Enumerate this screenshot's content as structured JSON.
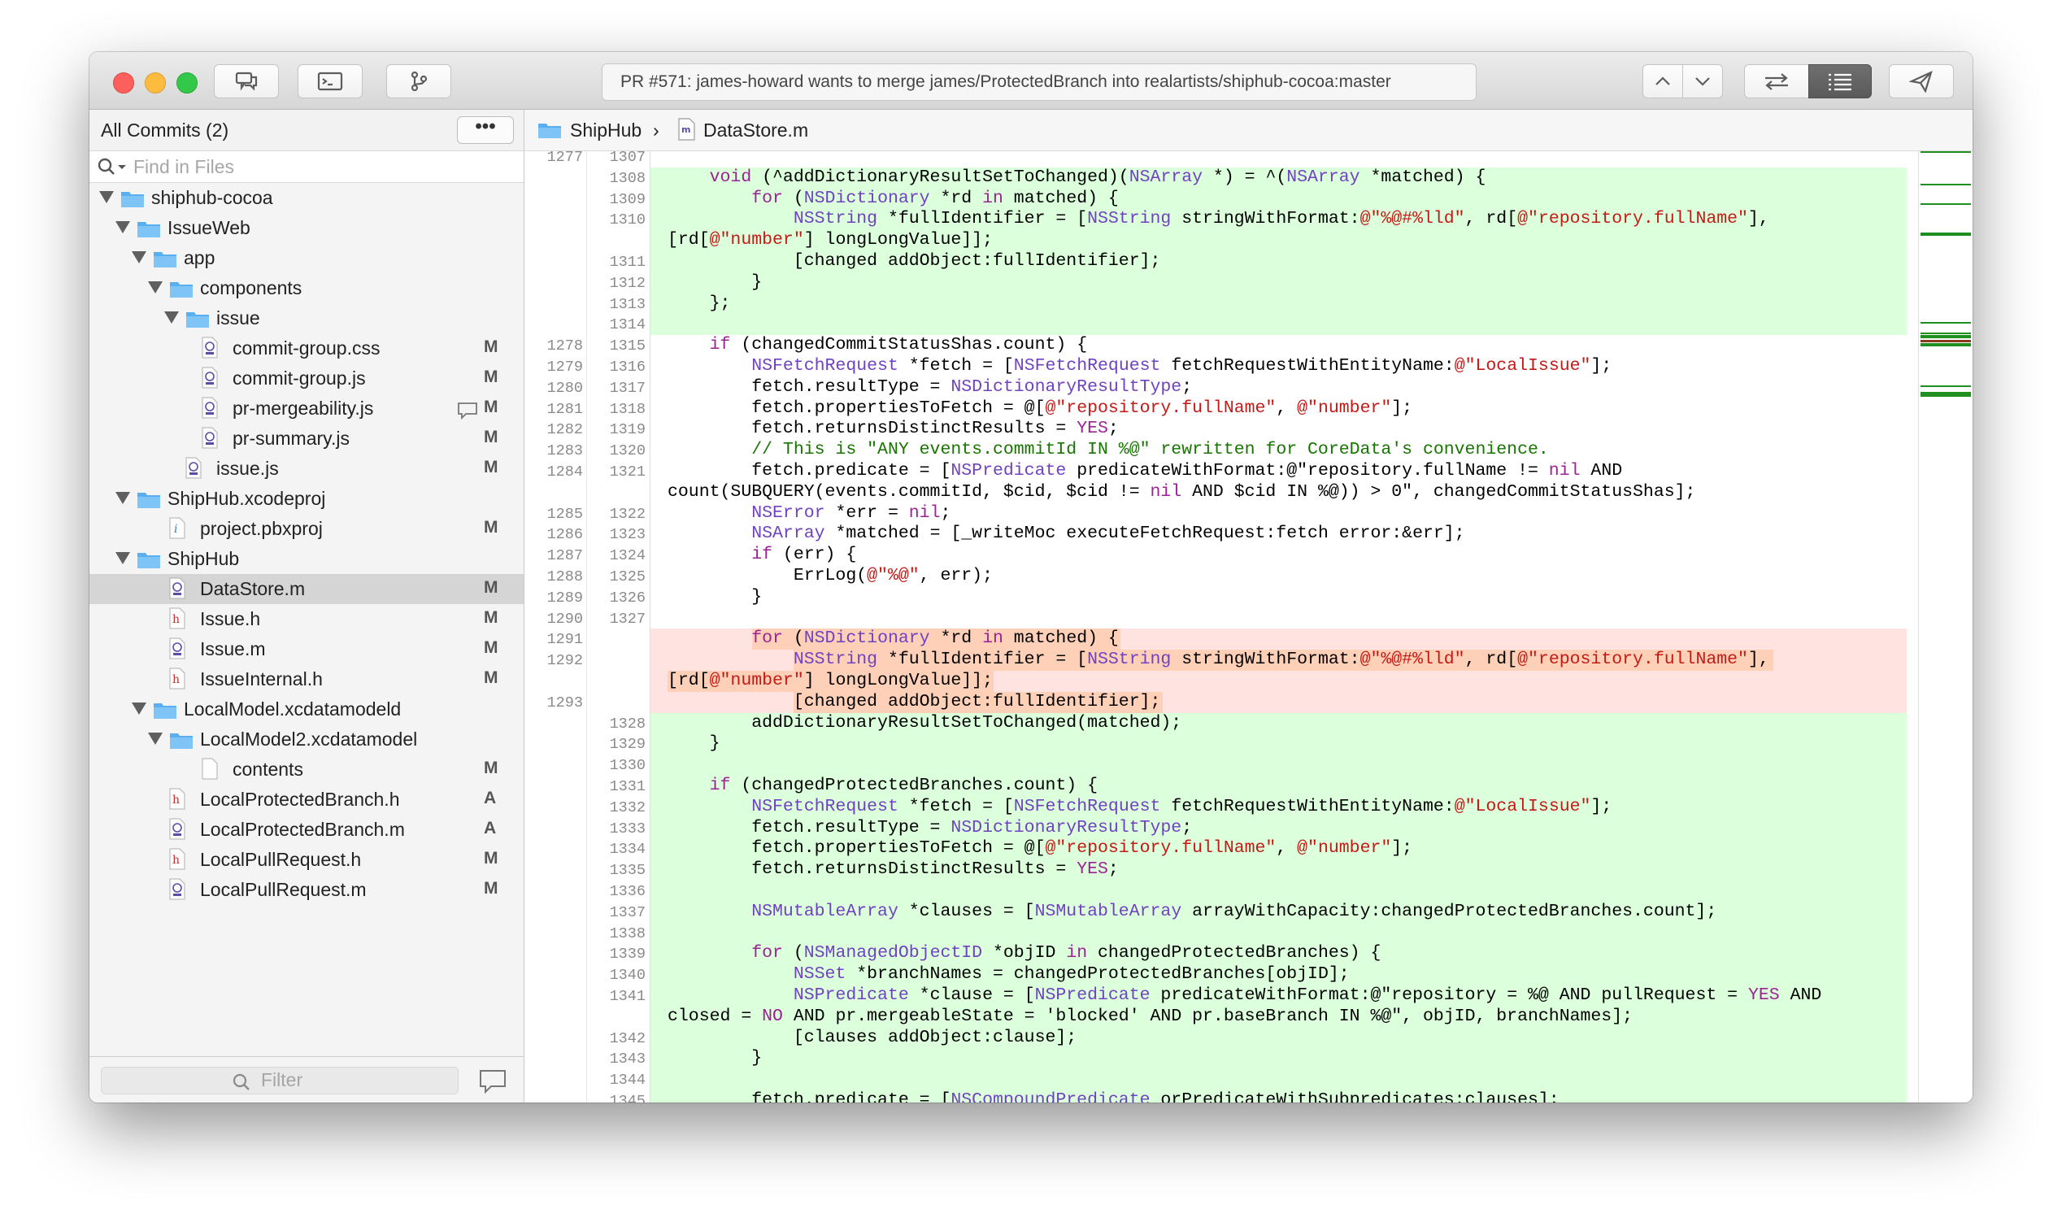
{
  "window": {
    "title": "PR #571: james-howard wants to merge james/ProtectedBranch into realartists/shiphub-cocoa:master"
  },
  "toolbar": {
    "left_icons": [
      "comments-icon",
      "terminal-icon",
      "branch-icon"
    ],
    "right_icons": [
      "chevron-up-icon",
      "chevron-down-icon",
      "swap-icon",
      "list-icon",
      "send-icon"
    ]
  },
  "sidebar": {
    "title": "All Commits (2)",
    "more_label": "•••",
    "search_placeholder": "Find in Files",
    "filter_placeholder": "Filter",
    "items": [
      {
        "label": "shiphub-cocoa",
        "kind": "folder",
        "level": 0,
        "expanded": true,
        "status": ""
      },
      {
        "label": "IssueWeb",
        "kind": "folder",
        "level": 1,
        "expanded": true,
        "status": ""
      },
      {
        "label": "app",
        "kind": "folder",
        "level": 2,
        "expanded": true,
        "status": ""
      },
      {
        "label": "components",
        "kind": "folder",
        "level": 3,
        "expanded": true,
        "status": ""
      },
      {
        "label": "issue",
        "kind": "folder",
        "level": 4,
        "expanded": true,
        "status": ""
      },
      {
        "label": "commit-group.css",
        "kind": "file",
        "level": 5,
        "status": "M"
      },
      {
        "label": "commit-group.js",
        "kind": "file",
        "level": 5,
        "status": "M"
      },
      {
        "label": "pr-mergeability.js",
        "kind": "file",
        "level": 5,
        "status": "M",
        "has_comment": true
      },
      {
        "label": "pr-summary.js",
        "kind": "file",
        "level": 5,
        "status": "M"
      },
      {
        "label": "issue.js",
        "kind": "file",
        "level": 4,
        "status": "M"
      },
      {
        "label": "ShipHub.xcodeproj",
        "kind": "folder",
        "level": 1,
        "expanded": true,
        "status": ""
      },
      {
        "label": "project.pbxproj",
        "kind": "pbx",
        "level": 3,
        "status": "M"
      },
      {
        "label": "ShipHub",
        "kind": "folder",
        "level": 1,
        "expanded": true,
        "status": ""
      },
      {
        "label": "DataStore.m",
        "kind": "file",
        "level": 3,
        "status": "M",
        "selected": true
      },
      {
        "label": "Issue.h",
        "kind": "header",
        "level": 3,
        "status": "M"
      },
      {
        "label": "Issue.m",
        "kind": "file",
        "level": 3,
        "status": "M"
      },
      {
        "label": "IssueInternal.h",
        "kind": "header",
        "level": 3,
        "status": "M"
      },
      {
        "label": "LocalModel.xcdatamodeld",
        "kind": "folder",
        "level": 2,
        "expanded": true,
        "status": ""
      },
      {
        "label": "LocalModel2.xcdatamodel",
        "kind": "folder",
        "level": 3,
        "expanded": true,
        "status": ""
      },
      {
        "label": "contents",
        "kind": "blank",
        "level": 5,
        "status": "M"
      },
      {
        "label": "LocalProtectedBranch.h",
        "kind": "header",
        "level": 3,
        "status": "A"
      },
      {
        "label": "LocalProtectedBranch.m",
        "kind": "file",
        "level": 3,
        "status": "A"
      },
      {
        "label": "LocalPullRequest.h",
        "kind": "header",
        "level": 3,
        "status": "M"
      },
      {
        "label": "LocalPullRequest.m",
        "kind": "file",
        "level": 3,
        "status": "M"
      }
    ]
  },
  "breadcrumb": {
    "project": "ShipHub",
    "separator": "›",
    "file": "DataStore.m"
  },
  "colors": {
    "added_bg": "#dcffdc",
    "removed_bg": "#ffe3e0",
    "removed_highlight": "#ffd0b8",
    "keyword": "#9b2393",
    "type": "#6f42c1",
    "string": "#c41a16",
    "comment": "#177500"
  },
  "code": {
    "lines": [
      {
        "old": "1277",
        "new": "1307",
        "type": "ctx",
        "text": ""
      },
      {
        "old": "",
        "new": "1308",
        "type": "add",
        "text": "    void (^addDictionaryResultSetToChanged)(NSArray *) = ^(NSArray *matched) {"
      },
      {
        "old": "",
        "new": "1309",
        "type": "add",
        "text": "        for (NSDictionary *rd in matched) {"
      },
      {
        "old": "",
        "new": "1310",
        "type": "add",
        "text": "            NSString *fullIdentifier = [NSString stringWithFormat:@\"%@#%lld\", rd[@\"repository.fullName\"],"
      },
      {
        "old": "",
        "new": "",
        "type": "add",
        "text": "[rd[@\"number\"] longLongValue]];"
      },
      {
        "old": "",
        "new": "1311",
        "type": "add",
        "text": "            [changed addObject:fullIdentifier];"
      },
      {
        "old": "",
        "new": "1312",
        "type": "add",
        "text": "        }"
      },
      {
        "old": "",
        "new": "1313",
        "type": "add",
        "text": "    };"
      },
      {
        "old": "",
        "new": "1314",
        "type": "add",
        "text": ""
      },
      {
        "old": "1278",
        "new": "1315",
        "type": "ctx",
        "text": "    if (changedCommitStatusShas.count) {"
      },
      {
        "old": "1279",
        "new": "1316",
        "type": "ctx",
        "text": "        NSFetchRequest *fetch = [NSFetchRequest fetchRequestWithEntityName:@\"LocalIssue\"];"
      },
      {
        "old": "1280",
        "new": "1317",
        "type": "ctx",
        "text": "        fetch.resultType = NSDictionaryResultType;"
      },
      {
        "old": "1281",
        "new": "1318",
        "type": "ctx",
        "text": "        fetch.propertiesToFetch = @[@\"repository.fullName\", @\"number\"];"
      },
      {
        "old": "1282",
        "new": "1319",
        "type": "ctx",
        "text": "        fetch.returnsDistinctResults = YES;"
      },
      {
        "old": "1283",
        "new": "1320",
        "type": "ctx",
        "text": "        // This is \"ANY events.commitId IN %@\" rewritten for CoreData's convenience."
      },
      {
        "old": "1284",
        "new": "1321",
        "type": "ctx",
        "text": "        fetch.predicate = [NSPredicate predicateWithFormat:@\"repository.fullName != nil AND"
      },
      {
        "old": "",
        "new": "",
        "type": "ctx",
        "text": "count(SUBQUERY(events.commitId, $cid, $cid != nil AND $cid IN %@)) > 0\", changedCommitStatusShas];"
      },
      {
        "old": "1285",
        "new": "1322",
        "type": "ctx",
        "text": "        NSError *err = nil;"
      },
      {
        "old": "1286",
        "new": "1323",
        "type": "ctx",
        "text": "        NSArray *matched = [_writeMoc executeFetchRequest:fetch error:&err];"
      },
      {
        "old": "1287",
        "new": "1324",
        "type": "ctx",
        "text": "        if (err) {"
      },
      {
        "old": "1288",
        "new": "1325",
        "type": "ctx",
        "text": "            ErrLog(@\"%@\", err);"
      },
      {
        "old": "1289",
        "new": "1326",
        "type": "ctx",
        "text": "        }"
      },
      {
        "old": "1290",
        "new": "1327",
        "type": "ctx",
        "text": ""
      },
      {
        "old": "1291",
        "new": "",
        "type": "del",
        "text": "        for (NSDictionary *rd in matched) {"
      },
      {
        "old": "1292",
        "new": "",
        "type": "del",
        "text": "            NSString *fullIdentifier = [NSString stringWithFormat:@\"%@#%lld\", rd[@\"repository.fullName\"],"
      },
      {
        "old": "",
        "new": "",
        "type": "del",
        "text": "[rd[@\"number\"] longLongValue]];"
      },
      {
        "old": "1293",
        "new": "",
        "type": "del",
        "text": "            [changed addObject:fullIdentifier];"
      },
      {
        "old": "",
        "new": "1328",
        "type": "add",
        "text": "        addDictionaryResultSetToChanged(matched);"
      },
      {
        "old": "",
        "new": "1329",
        "type": "add",
        "text": "    }"
      },
      {
        "old": "",
        "new": "1330",
        "type": "add",
        "text": ""
      },
      {
        "old": "",
        "new": "1331",
        "type": "add",
        "text": "    if (changedProtectedBranches.count) {"
      },
      {
        "old": "",
        "new": "1332",
        "type": "add",
        "text": "        NSFetchRequest *fetch = [NSFetchRequest fetchRequestWithEntityName:@\"LocalIssue\"];"
      },
      {
        "old": "",
        "new": "1333",
        "type": "add",
        "text": "        fetch.resultType = NSDictionaryResultType;"
      },
      {
        "old": "",
        "new": "1334",
        "type": "add",
        "text": "        fetch.propertiesToFetch = @[@\"repository.fullName\", @\"number\"];"
      },
      {
        "old": "",
        "new": "1335",
        "type": "add",
        "text": "        fetch.returnsDistinctResults = YES;"
      },
      {
        "old": "",
        "new": "1336",
        "type": "add",
        "text": ""
      },
      {
        "old": "",
        "new": "1337",
        "type": "add",
        "text": "        NSMutableArray *clauses = [NSMutableArray arrayWithCapacity:changedProtectedBranches.count];"
      },
      {
        "old": "",
        "new": "1338",
        "type": "add",
        "text": ""
      },
      {
        "old": "",
        "new": "1339",
        "type": "add",
        "text": "        for (NSManagedObjectID *objID in changedProtectedBranches) {"
      },
      {
        "old": "",
        "new": "1340",
        "type": "add",
        "text": "            NSSet *branchNames = changedProtectedBranches[objID];"
      },
      {
        "old": "",
        "new": "1341",
        "type": "add",
        "text": "            NSPredicate *clause = [NSPredicate predicateWithFormat:@\"repository = %@ AND pullRequest = YES AND"
      },
      {
        "old": "",
        "new": "",
        "type": "add",
        "text": "closed = NO AND pr.mergeableState = 'blocked' AND pr.baseBranch IN %@\", objID, branchNames];"
      },
      {
        "old": "",
        "new": "1342",
        "type": "add",
        "text": "            [clauses addObject:clause];"
      },
      {
        "old": "",
        "new": "1343",
        "type": "add",
        "text": "        }"
      },
      {
        "old": "",
        "new": "1344",
        "type": "add",
        "text": ""
      },
      {
        "old": "",
        "new": "1345",
        "type": "add",
        "text": "        fetch.predicate = [NSCompoundPredicate orPredicateWithSubpredicates:clauses];"
      }
    ]
  }
}
